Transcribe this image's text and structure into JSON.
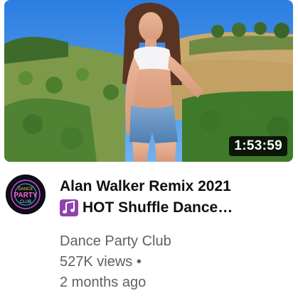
{
  "video": {
    "duration": "1:53:59",
    "title_line1": "Alan Walker Remix 2021",
    "title_line2": "HOT Shuffle Dance…",
    "title_emoji": "music-notes-icon",
    "channel": "Dance Party Club",
    "views": "527K views",
    "separator": "•",
    "age": "2 months ago"
  },
  "avatar": {
    "line1": "DANCE",
    "line2": "PARTY",
    "line3": "CLUB"
  },
  "colors": {
    "title": "#0f0f0f",
    "secondary": "#606060",
    "duration_bg": "#000000",
    "emoji_bg": "#8e44ad"
  }
}
